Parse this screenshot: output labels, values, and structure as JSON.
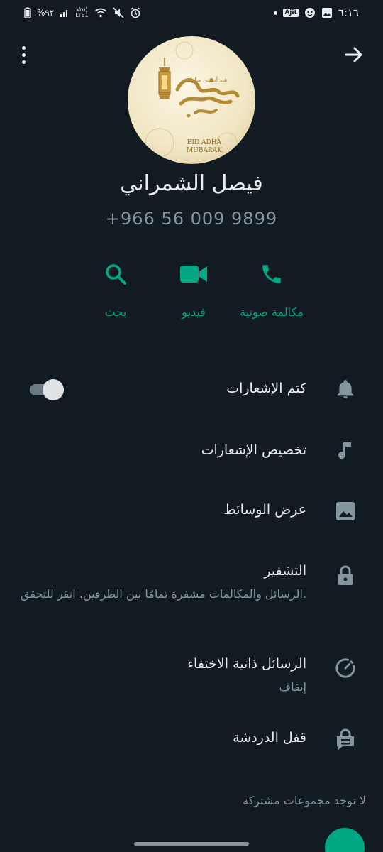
{
  "status_bar": {
    "time": "٦:١٦",
    "battery_text": "%٩٢",
    "network_badge": "Ajit",
    "lte_top": "Vo))",
    "lte_bottom": "LTE1"
  },
  "header": {
    "avatar": {
      "arabic_art": "عيد أضحى مبارك",
      "line1": "EID ADHA",
      "line2": "MUBARAK"
    },
    "name": "فيصل الشمراني",
    "phone": "+966 56 009 9899"
  },
  "actions": [
    {
      "label": "مكالمة صوتية",
      "icon": "phone-icon"
    },
    {
      "label": "فيديو",
      "icon": "video-icon"
    },
    {
      "label": "بحث",
      "icon": "search-icon"
    }
  ],
  "settings": {
    "mute": {
      "label": "كتم الإشعارات",
      "icon": "bell-icon",
      "enabled": true
    },
    "custom": {
      "label": "تخصيص الإشعارات",
      "icon": "music-note-icon"
    },
    "media": {
      "label": "عرض الوسائط",
      "icon": "image-icon"
    }
  },
  "security": {
    "encryption": {
      "title": "التشفير",
      "subtitle": "الرسائل والمكالمات مشفرة تمامًا بين الطرفين. انقر للتحقق.",
      "icon": "lock-icon"
    },
    "disappearing": {
      "title": "الرسائل ذاتية الاختفاء",
      "subtitle": "إيقاف",
      "icon": "timer-icon"
    },
    "chat_lock": {
      "title": "قفل الدردشة",
      "icon": "chat-lock-icon"
    }
  },
  "groups": {
    "empty_text": "لا توجد مجموعات مشتركة"
  },
  "colors": {
    "background": "#111b21",
    "divider": "#0b141a",
    "accent": "#00a884",
    "text_primary": "#e9edef",
    "text_secondary": "#8696a0"
  }
}
